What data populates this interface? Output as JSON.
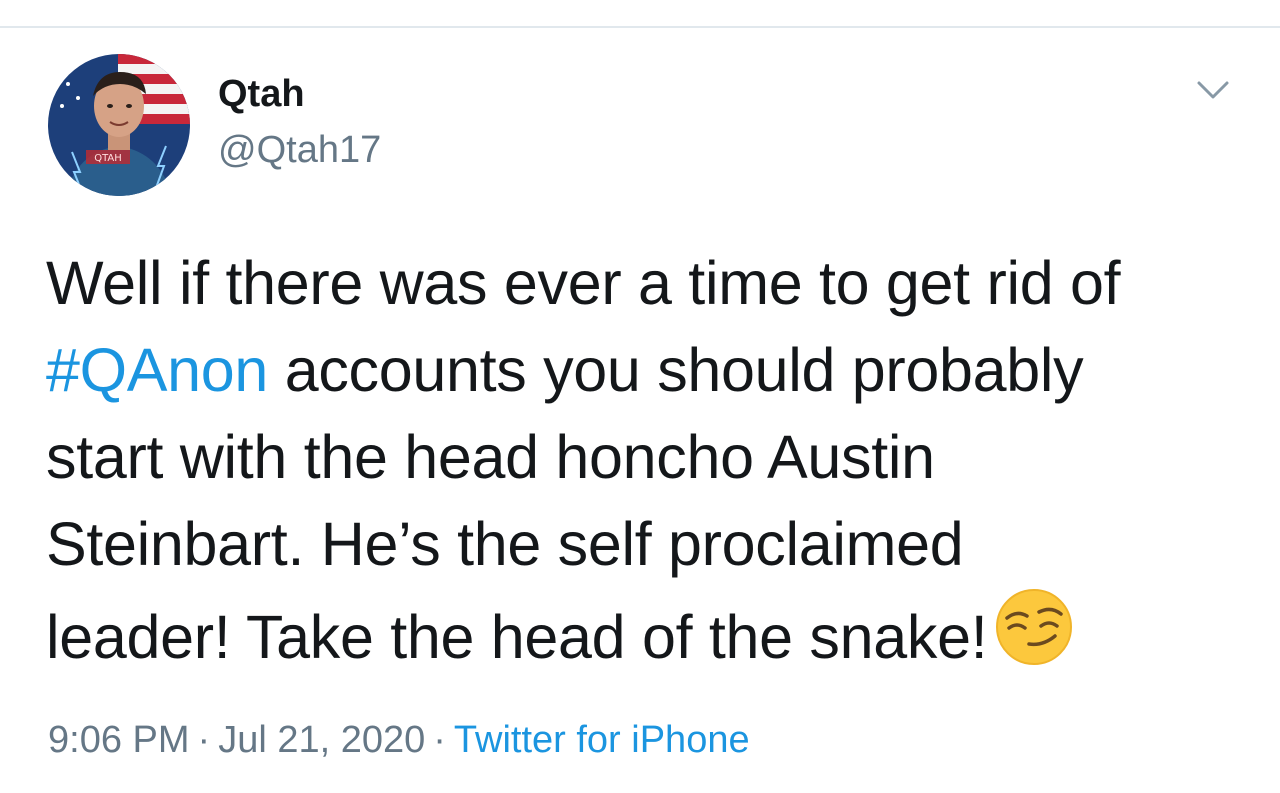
{
  "tweet": {
    "author": {
      "name": "Qtah",
      "handle": "@Qtah17",
      "avatar_text": "QTAH"
    },
    "text": {
      "line1": "Well if there was ever a time to get rid of",
      "hashtag": "#QAnon",
      "line2_rest": " accounts you should probably",
      "line3": "start with the head honcho Austin",
      "line4": "Steinbart. He’s the self proclaimed",
      "line5": "leader! Take the head of the snake!"
    },
    "emoji": "smirking-face-icon",
    "meta": {
      "time": "9:06 PM",
      "separator": "·",
      "date": "Jul 21, 2020",
      "source": "Twitter for iPhone"
    }
  },
  "colors": {
    "text": "#14171a",
    "secondary": "#657786",
    "link": "#1b95e0",
    "divider": "#e1e8ed"
  }
}
